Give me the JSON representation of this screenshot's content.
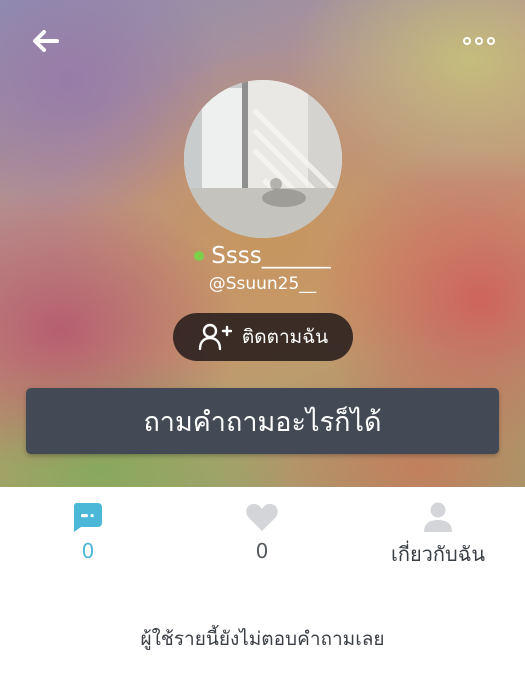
{
  "header": {
    "back_icon": "arrow-left-icon",
    "more_icon": "more-options-icon"
  },
  "profile": {
    "display_name": "Ssss______",
    "username": "@Ssuun25__",
    "online_status_color": "#7ed04b",
    "follow_label": "ติดตามฉัน",
    "follow_icon": "person-add-icon"
  },
  "ask": {
    "label": "ถามคำถามอะไรก็ได้"
  },
  "tabs": [
    {
      "id": "answers",
      "icon": "chat-bubble-icon",
      "count": "0",
      "active": true,
      "color": "#4cb8d8"
    },
    {
      "id": "likes",
      "icon": "heart-icon",
      "count": "0",
      "active": false,
      "color": "#555a60"
    },
    {
      "id": "about",
      "icon": "person-icon",
      "label": "เกี่ยวกับฉัน",
      "active": false,
      "color": "#3a3f45"
    }
  ],
  "empty_state": {
    "message": "ผู้ใช้รายนี้ยังไม่ตอบคำถามเลย"
  }
}
